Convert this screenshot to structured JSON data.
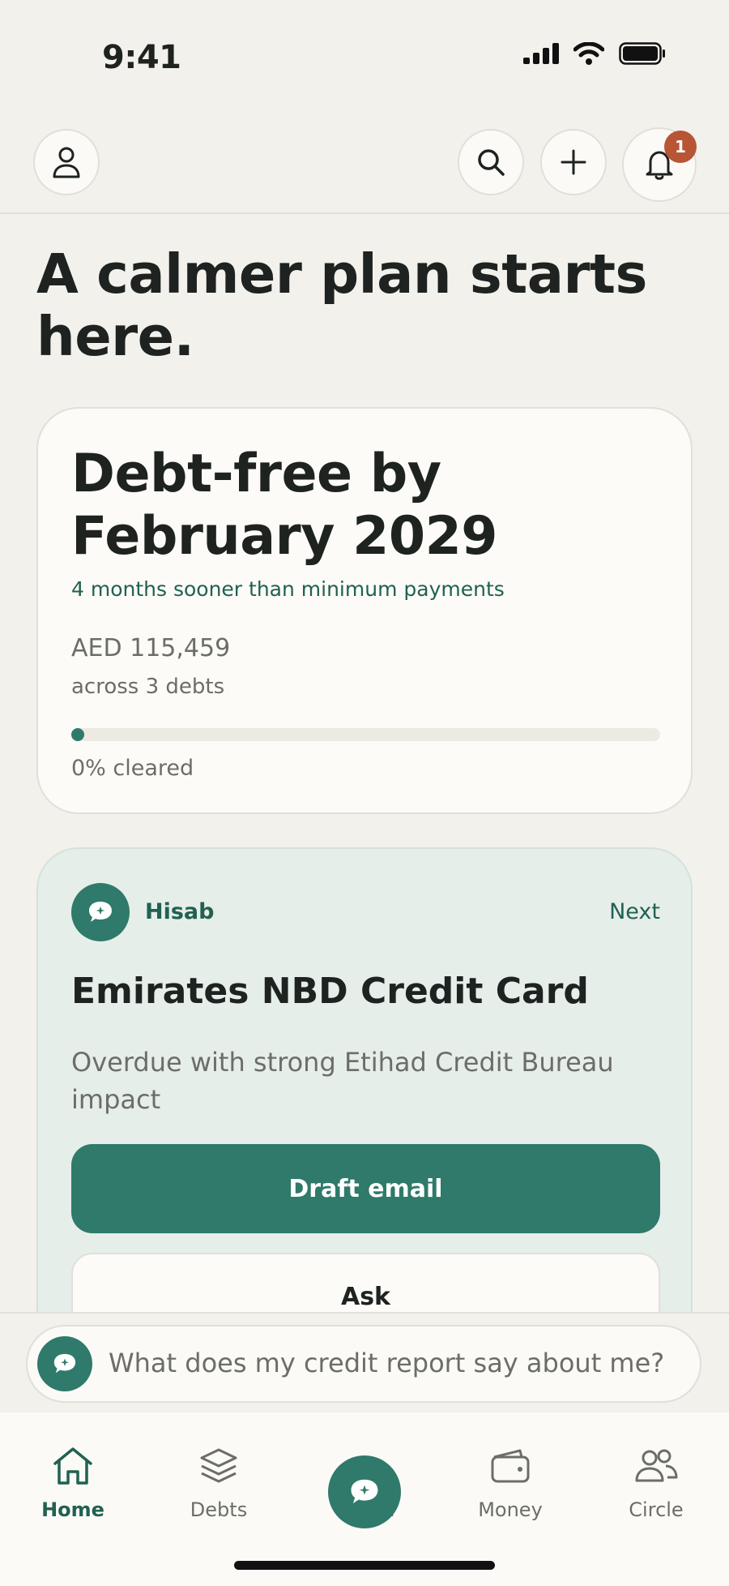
{
  "status_bar": {
    "time": "9:41",
    "icons": [
      "signal-icon",
      "wifi-icon",
      "battery-icon"
    ]
  },
  "header": {
    "buttons": [
      "profile-icon",
      "search-icon",
      "plus-icon",
      "bell-icon"
    ],
    "notification_count": "1"
  },
  "hero": {
    "title": "A calmer plan starts here."
  },
  "plan": {
    "title": "Debt-free by February 2029",
    "subtitle": "4 months sooner than minimum payments",
    "amount": "AED 115,459",
    "debts_label": "across 3 debts",
    "progress_percent": 0,
    "cleared_label": "0% cleared"
  },
  "coach_card": {
    "name": "Hisab",
    "next_label": "Next",
    "title": "Emirates NBD Credit Card",
    "description": "Overdue with strong Etihad Credit Bureau impact",
    "primary_action": "Draft email",
    "secondary_action": "Ask"
  },
  "ask_bar": {
    "placeholder": "What does my credit report say about me?"
  },
  "tabs": [
    {
      "label": "Home",
      "icon": "home-icon",
      "active": true
    },
    {
      "label": "Debts",
      "icon": "layers-icon",
      "active": false
    },
    {
      "label": "Coach",
      "icon": "chat-bubble-icon",
      "active": false
    },
    {
      "label": "Money",
      "icon": "wallet-icon",
      "active": false
    },
    {
      "label": "Circle",
      "icon": "people-icon",
      "active": false
    }
  ],
  "colors": {
    "accent": "#2F7A6A",
    "background": "#F3F1EC",
    "badge": "#B85535"
  }
}
